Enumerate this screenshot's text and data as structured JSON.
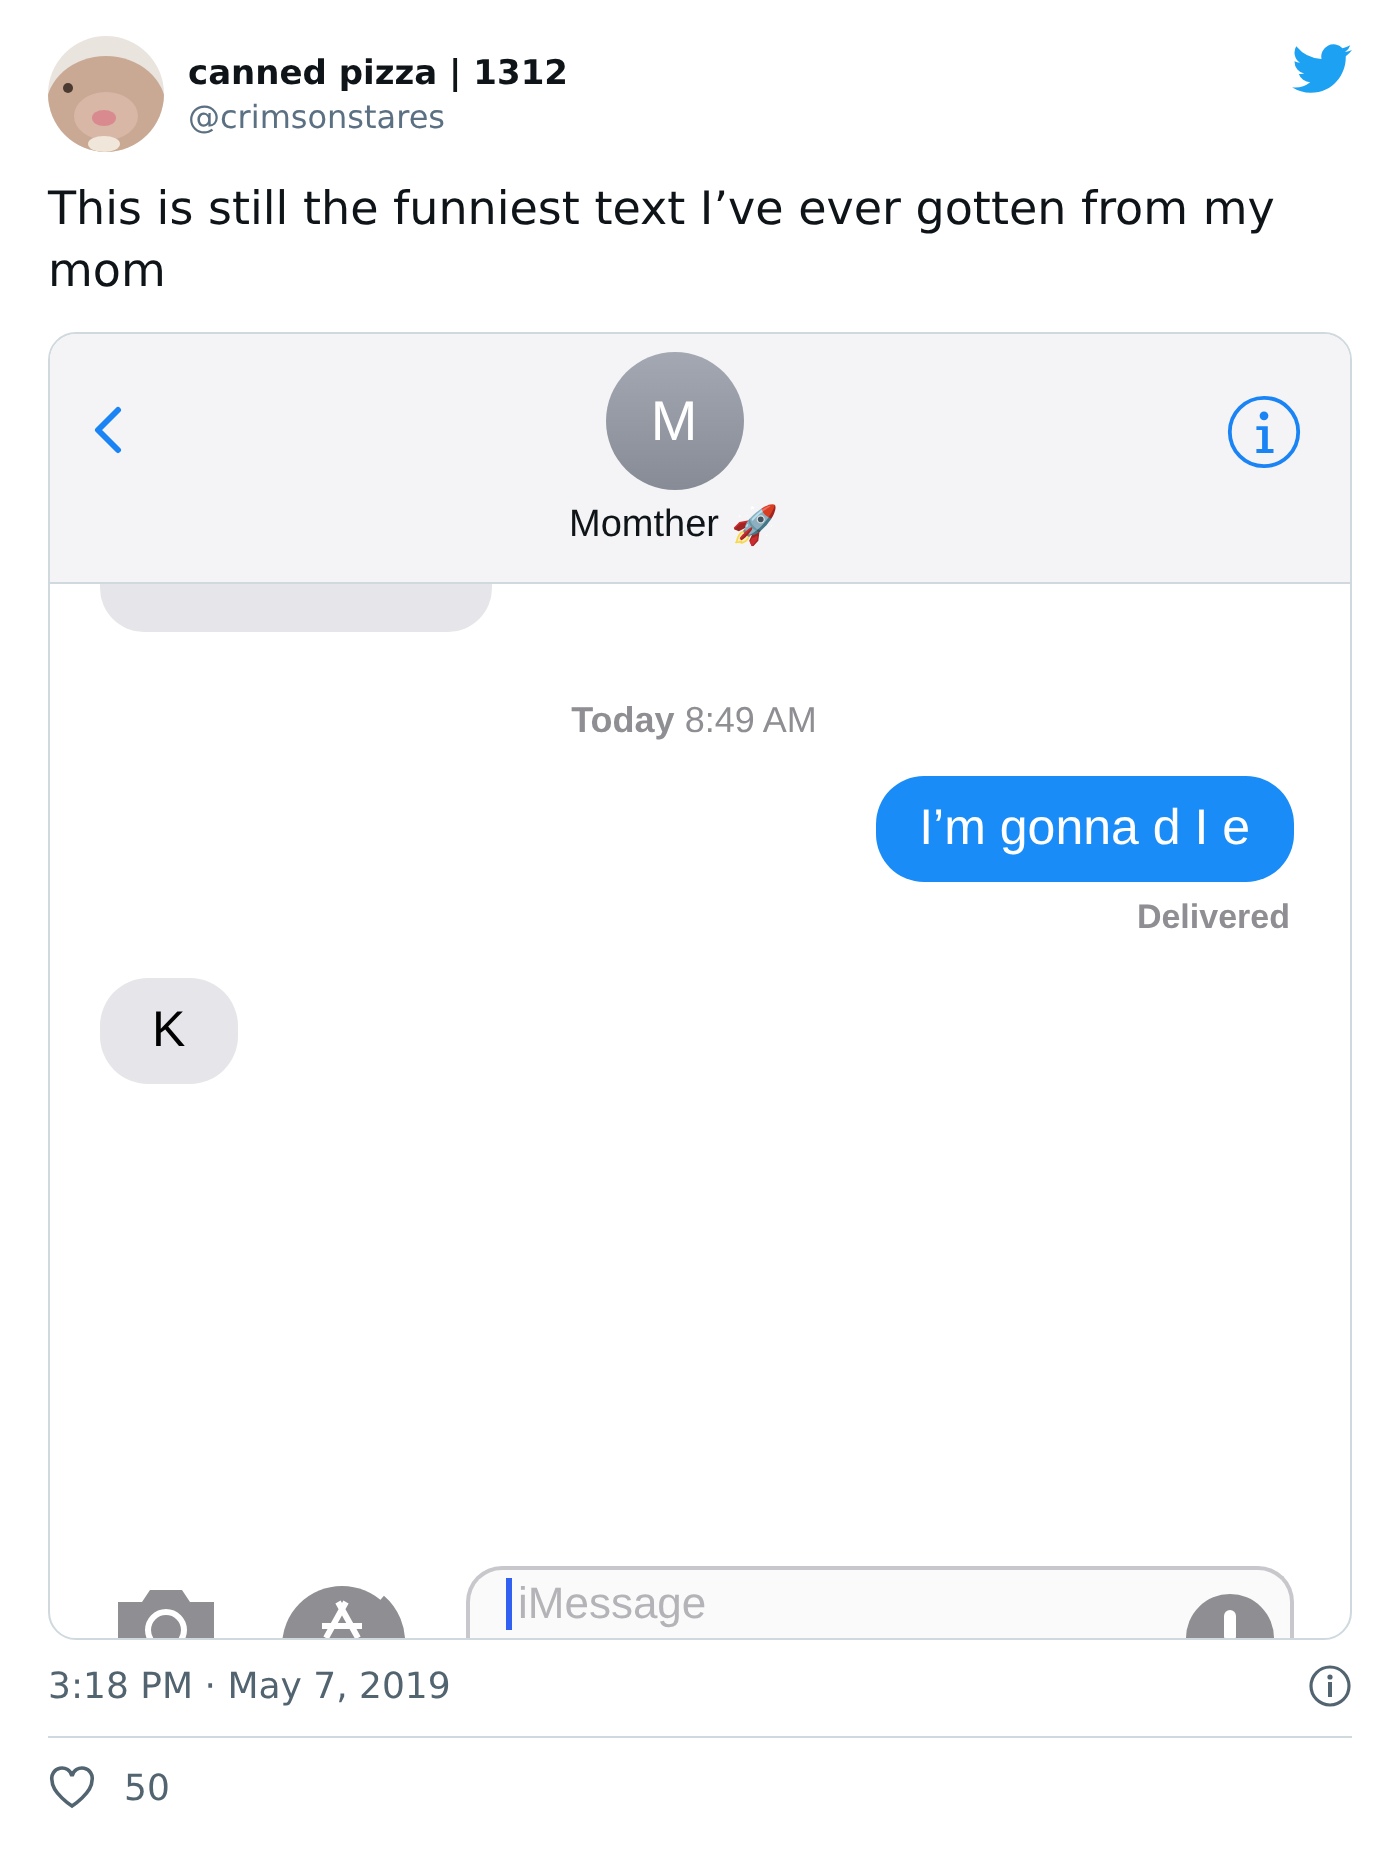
{
  "author": {
    "name": "canned pizza | 1312",
    "handle": "@crimsonstares"
  },
  "tweet_text": "This is still the funniest text I’ve ever gotten from my mom",
  "messages_screen": {
    "contact": {
      "initial": "M",
      "name": "Momther",
      "emoji": "🚀"
    },
    "messages": [
      {
        "kind": "cut_incoming"
      },
      {
        "kind": "timestamp",
        "day": "Today",
        "time": "8:49 AM"
      },
      {
        "kind": "outgoing",
        "text": "I’m gonna d I e"
      },
      {
        "kind": "status",
        "text": "Delivered"
      },
      {
        "kind": "incoming",
        "text": "K"
      }
    ],
    "compose": {
      "placeholder": "iMessage"
    }
  },
  "timestamp": "3:18 PM · May 7, 2019",
  "likes": "50"
}
